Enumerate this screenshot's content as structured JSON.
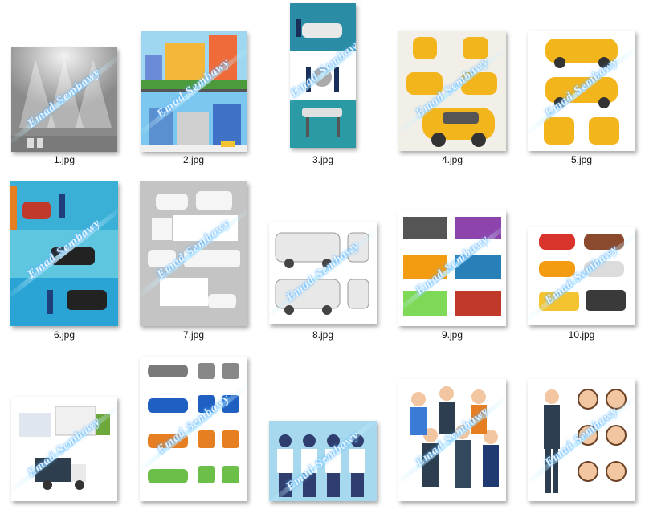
{
  "watermark": "Emad Sembawy",
  "files": [
    {
      "name": "1.jpg",
      "icon": "empty-room-spotlights"
    },
    {
      "name": "2.jpg",
      "icon": "city-buildings"
    },
    {
      "name": "3.jpg",
      "icon": "car-service-mechanics"
    },
    {
      "name": "4.jpg",
      "icon": "yellow-hatchback-views"
    },
    {
      "name": "5.jpg",
      "icon": "yellow-hatchback-views"
    },
    {
      "name": "6.jpg",
      "icon": "car-repair-garage"
    },
    {
      "name": "7.jpg",
      "icon": "white-vehicles-set"
    },
    {
      "name": "8.jpg",
      "icon": "white-van-views"
    },
    {
      "name": "9.jpg",
      "icon": "colored-trucks"
    },
    {
      "name": "10.jpg",
      "icon": "colored-cars"
    },
    {
      "name": "",
      "icon": "delivery-trucks"
    },
    {
      "name": "",
      "icon": "colored-cars-grid"
    },
    {
      "name": "",
      "icon": "business-men-group"
    },
    {
      "name": "",
      "icon": "business-people-group"
    },
    {
      "name": "",
      "icon": "businessman-faces"
    }
  ]
}
